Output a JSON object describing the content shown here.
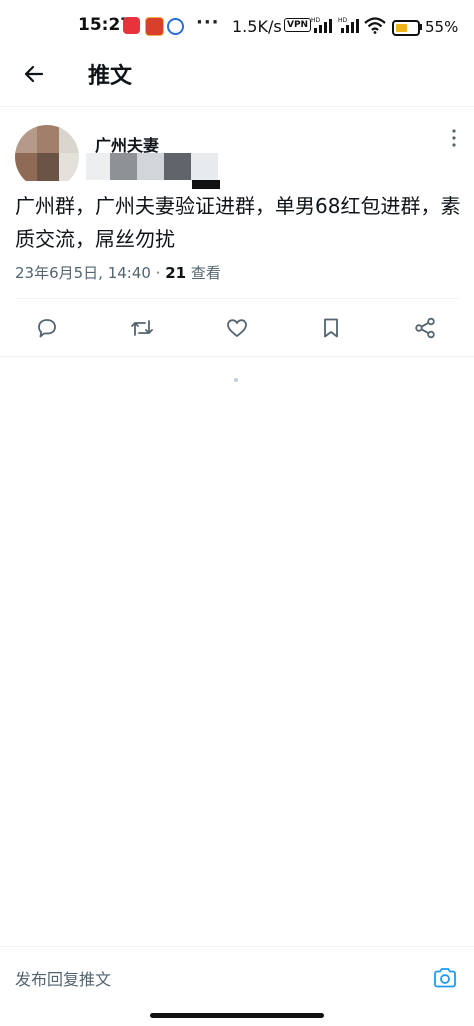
{
  "status_bar": {
    "time": "15:27",
    "dots": "···",
    "net_speed": "1.5K/s",
    "vpn": "VPN",
    "battery_level": 0.55,
    "battery_percent": "55%"
  },
  "header": {
    "back_icon": "arrow-left-icon",
    "title": "推文"
  },
  "tweet": {
    "author_name": "广州夫妻",
    "text": "广州群，广州夫妻验证进群，单男68红包进群，素质交流，屌丝勿扰",
    "timestamp": "23年6月5日, 14:40 · ",
    "views_count": "21",
    "views_label": " 查看"
  },
  "actions": [
    {
      "icon": "reply-icon"
    },
    {
      "icon": "retweet-icon"
    },
    {
      "icon": "like-icon"
    },
    {
      "icon": "bookmark-icon"
    },
    {
      "icon": "share-icon"
    }
  ],
  "reply_bar": {
    "placeholder": "发布回复推文",
    "camera_icon": "camera-icon"
  },
  "colors": {
    "accent": "#1d9bf0",
    "text_primary": "#0f1419",
    "text_secondary": "#536471",
    "divider": "#eff3f4",
    "battery": "#f0b418"
  }
}
